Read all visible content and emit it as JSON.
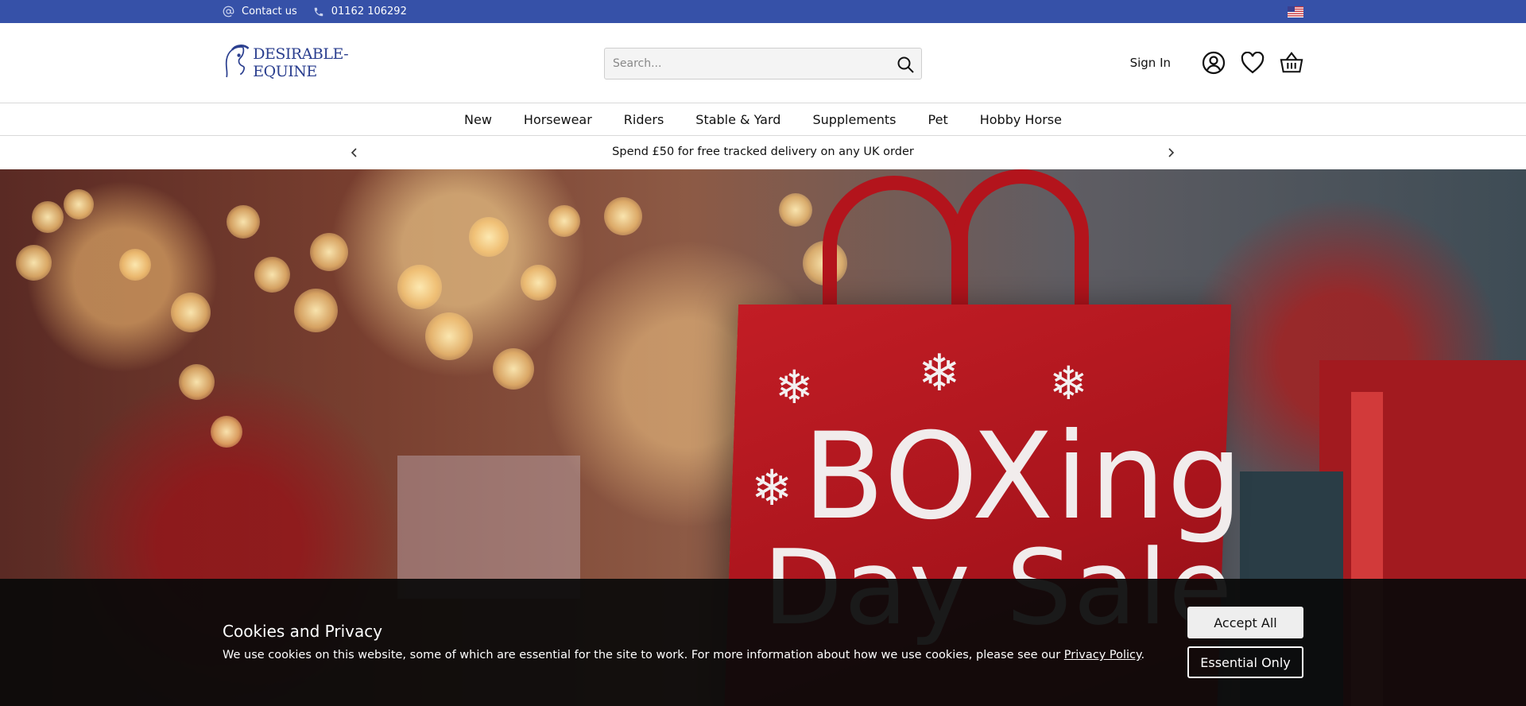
{
  "topbar": {
    "contact_label": "Contact us",
    "phone": "01162 106292",
    "contact_icon": "at-icon",
    "phone_icon": "phone-icon",
    "flag_icon": "us-flag-icon",
    "bg_color": "#3651a8"
  },
  "header": {
    "logo_text": "DESIRABLE-EQUINE",
    "search_placeholder": "Search...",
    "signin_label": "Sign In",
    "icons": [
      "search-icon",
      "account-icon",
      "heart-icon",
      "basket-icon"
    ]
  },
  "nav": {
    "items": [
      {
        "label": "New"
      },
      {
        "label": "Horsewear"
      },
      {
        "label": "Riders"
      },
      {
        "label": "Stable & Yard"
      },
      {
        "label": "Supplements"
      },
      {
        "label": "Pet"
      },
      {
        "label": "Hobby Horse"
      }
    ]
  },
  "promo": {
    "text": "Spend £50 for free tracked delivery on any UK order"
  },
  "hero": {
    "bag_line1": "BOXing",
    "bag_line2": "Day Sale"
  },
  "cookie": {
    "title": "Cookies and Privacy",
    "text": "We use cookies on this website, some of which are essential for the site to work. For more information about how we use cookies, please see our ",
    "link_text": "Privacy Policy",
    "text_end": ".",
    "accept_label": "Accept All",
    "essential_label": "Essential Only"
  }
}
